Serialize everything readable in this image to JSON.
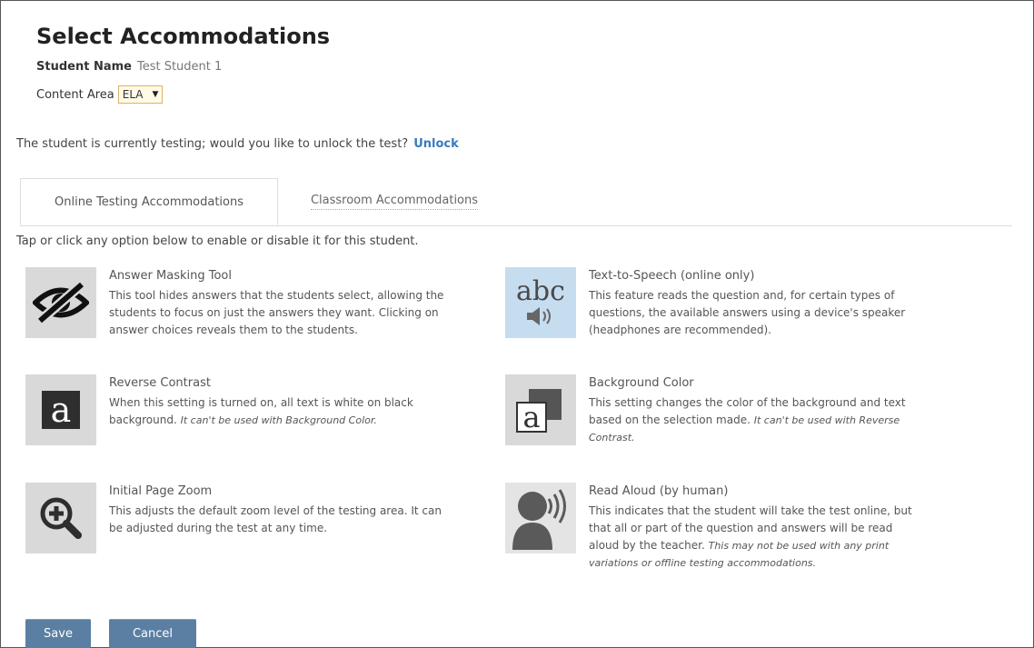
{
  "header": {
    "title": "Select Accommodations",
    "student_label": "Student Name",
    "student_value": "Test Student 1",
    "content_label": "Content Area",
    "content_value": "ELA"
  },
  "unlock": {
    "message": "The student is currently testing; would you like to unlock the test?",
    "link": "Unlock"
  },
  "tabs": [
    {
      "label": "Online Testing Accommodations",
      "active": true
    },
    {
      "label": "Classroom Accommodations",
      "active": false
    }
  ],
  "hint": "Tap or click any option below to enable or disable it for this student.",
  "options": [
    {
      "icon": "eye-slash-icon",
      "title": "Answer Masking Tool",
      "line1": "This tool hides answers that the students select, allowing the",
      "line2": "students to focus on just the answers they want. Clicking on",
      "line3": "answer choices reveals them to the students."
    },
    {
      "icon": "text-to-speech-icon",
      "icon_text": "abc",
      "title": "Text-to-Speech (online only)",
      "line1": "This feature reads the question and, for certain types of",
      "line2": "questions, the available answers using a device's speaker",
      "line3": "(headphones are recommended)."
    },
    {
      "icon": "reverse-contrast-icon",
      "icon_text": "a",
      "title": "Reverse Contrast",
      "line1": "When this setting is turned on, all text is white on black",
      "line2_prefix": "background.",
      "line2_em": "It can't be used with Background Color."
    },
    {
      "icon": "background-color-icon",
      "icon_text": "a",
      "title": "Background Color",
      "line1": "This setting changes the color of the background and text",
      "line2_prefix": "based on the selection made.",
      "line2_em": "It can't be used with Reverse",
      "line3_em": "Contrast."
    },
    {
      "icon": "zoom-in-icon",
      "title": "Initial Page Zoom",
      "line1": "This adjusts the default zoom level of the testing area. It can",
      "line2": "be adjusted during the test at any time."
    },
    {
      "icon": "read-aloud-icon",
      "title": "Read Aloud (by human)",
      "line1": "This indicates that the student will take the test online, but",
      "line2": "that all or part of the question and answers will be read",
      "line3_prefix": "aloud by the teacher.",
      "line3_em": "This may not be used with any print",
      "line4_em": "variations or offline testing accommodations."
    }
  ],
  "buttons": {
    "save": "Save",
    "cancel": "Cancel"
  },
  "colors": {
    "accent": "#3a7bb8",
    "button": "#5a7fa3",
    "icon_bg": "#d9d9d9",
    "tts_icon_bg": "#c6dcef"
  }
}
